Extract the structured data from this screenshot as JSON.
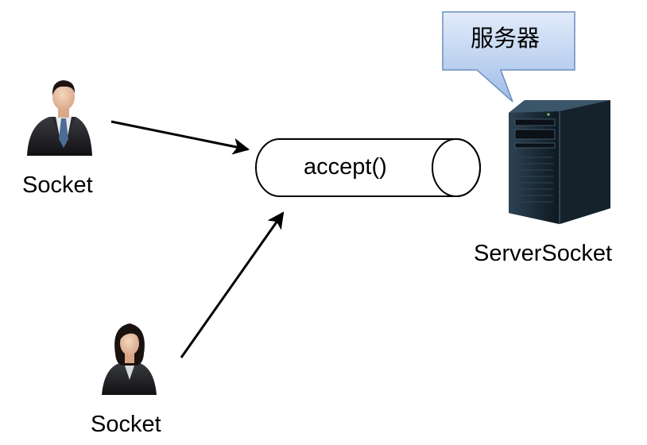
{
  "nodes": {
    "client_top": {
      "label": "Socket",
      "icon": "businessman-icon"
    },
    "client_bottom": {
      "label": "Socket",
      "icon": "businesswoman-icon"
    },
    "server": {
      "label": "ServerSocket",
      "icon": "server-tower-icon"
    },
    "channel": {
      "label": "accept()",
      "shape": "cylinder"
    }
  },
  "callout": {
    "label": "服务器"
  },
  "colors": {
    "callout_fill_top": "#e3ecfa",
    "callout_fill_bottom": "#9fbde8",
    "callout_stroke": "#6c8ebf",
    "arrow": "#000000",
    "cylinder_stroke": "#000000",
    "server_body": "#1a2a36",
    "suit": "#1f2024"
  }
}
